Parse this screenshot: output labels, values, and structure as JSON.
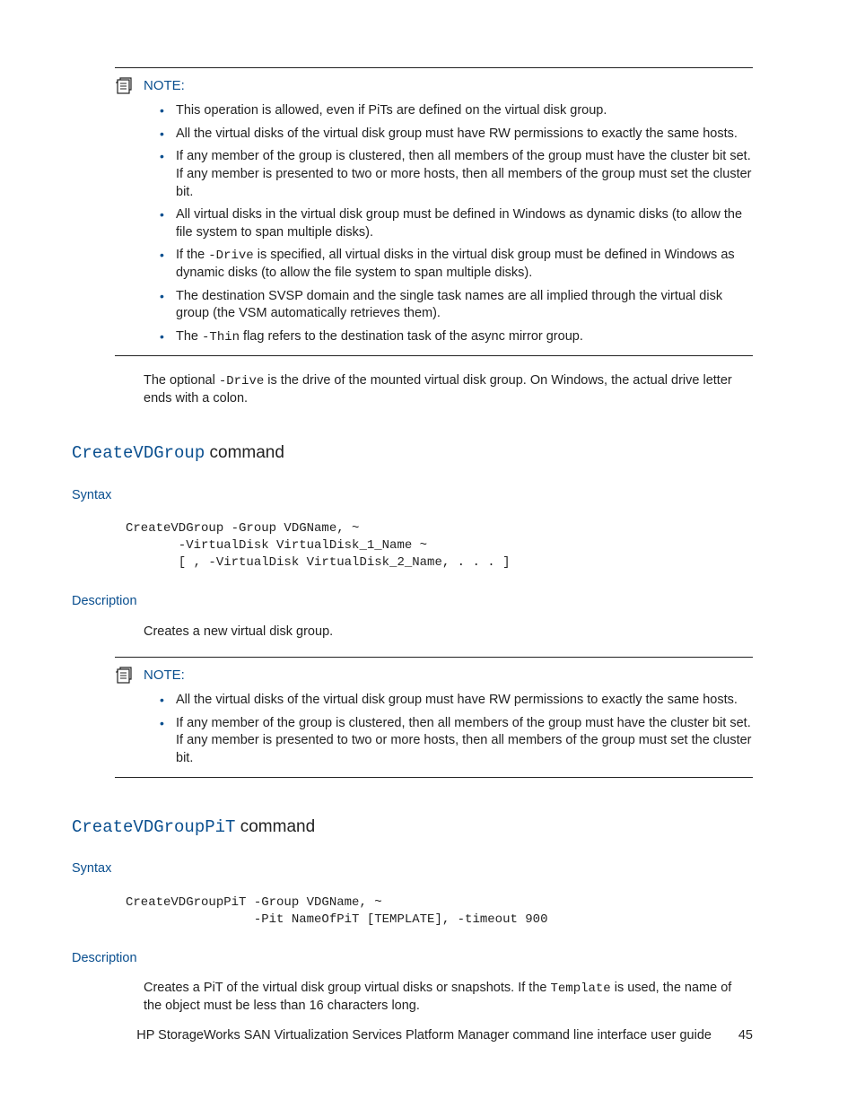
{
  "note1": {
    "label": "NOTE:",
    "items": [
      {
        "text": "This operation is allowed, even if PiTs are defined on the virtual disk group."
      },
      {
        "text": "All the virtual disks of the virtual disk group must have RW permissions to exactly the same hosts."
      },
      {
        "text": "If any member of the group is clustered, then all members of the group must have the cluster bit set. If any member is presented to two or more hosts, then all members of the group must set the cluster bit."
      },
      {
        "text": "All virtual disks in the virtual disk group must be defined in Windows as dynamic disks (to allow the file system to span multiple disks)."
      },
      {
        "pre": "If the ",
        "code": "-Drive",
        "post": " is specified, all virtual disks in the virtual disk group must be defined in Windows as dynamic disks (to allow the file system to span multiple disks)."
      },
      {
        "text": "The destination SVSP domain and the single task names are all implied through the virtual disk group (the VSM automatically retrieves them)."
      },
      {
        "pre": "The ",
        "code": "-Thin",
        "post": " flag refers to the destination task of the async mirror group."
      }
    ]
  },
  "after_note1": {
    "pre": "The optional ",
    "code": "-Drive",
    "post": " is the drive of the mounted virtual disk group. On Windows, the actual drive letter ends with a colon."
  },
  "section1": {
    "cmd": "CreateVDGroup",
    "word": " command",
    "syntax_label": "Syntax",
    "syntax_code": "CreateVDGroup -Group VDGName, ~\n       -VirtualDisk VirtualDisk_1_Name ~\n       [ , -VirtualDisk VirtualDisk_2_Name, . . . ]",
    "desc_label": "Description",
    "desc_text": "Creates a new virtual disk group."
  },
  "note2": {
    "label": "NOTE:",
    "items": [
      {
        "text": "All the virtual disks of the virtual disk group must have RW permissions to exactly the same hosts."
      },
      {
        "text": "If any member of the group is clustered, then all members of the group must have the cluster bit set. If any member is presented to two or more hosts, then all members of the group must set the cluster bit."
      }
    ]
  },
  "section2": {
    "cmd": "CreateVDGroupPiT",
    "word": " command",
    "syntax_label": "Syntax",
    "syntax_code": "CreateVDGroupPiT -Group VDGName, ~\n                 -Pit NameOfPiT [TEMPLATE], -timeout 900",
    "desc_label": "Description",
    "desc_pre": "Creates a PiT of the virtual disk group virtual disks or snapshots. If the ",
    "desc_code": "Template",
    "desc_post": " is used, the name of the object must be less than 16 characters long."
  },
  "footer": {
    "text": "HP StorageWorks SAN Virtualization Services Platform Manager command line interface user guide",
    "page": "45"
  }
}
